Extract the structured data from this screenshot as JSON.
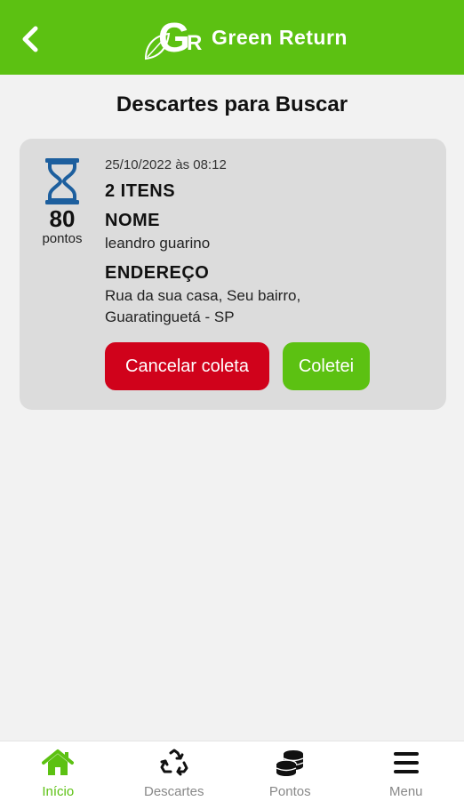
{
  "header": {
    "app_name": "Green Return",
    "logo_letters": "GR",
    "accent_color": "#5cc112"
  },
  "page": {
    "title": "Descartes para Buscar"
  },
  "card": {
    "status_icon": "hourglass-icon",
    "points_value": "80",
    "points_label": "pontos",
    "date": "25/10/2022 às 08:12",
    "items": "2 ITENS",
    "name_label": "NOME",
    "name_value": "leandro guarino",
    "address_label": "ENDEREÇO",
    "address_line1": "Rua da sua casa, Seu bairro,",
    "address_line2": "Guaratinguetá - SP",
    "cancel_label": "Cancelar coleta",
    "confirm_label": "Coletei",
    "cancel_color": "#d0021b"
  },
  "tabbar": {
    "tabs": [
      {
        "label": "Início",
        "icon": "home-icon",
        "active": true
      },
      {
        "label": "Descartes",
        "icon": "recycle-icon",
        "active": false
      },
      {
        "label": "Pontos",
        "icon": "coins-icon",
        "active": false
      },
      {
        "label": "Menu",
        "icon": "menu-icon",
        "active": false
      }
    ]
  }
}
